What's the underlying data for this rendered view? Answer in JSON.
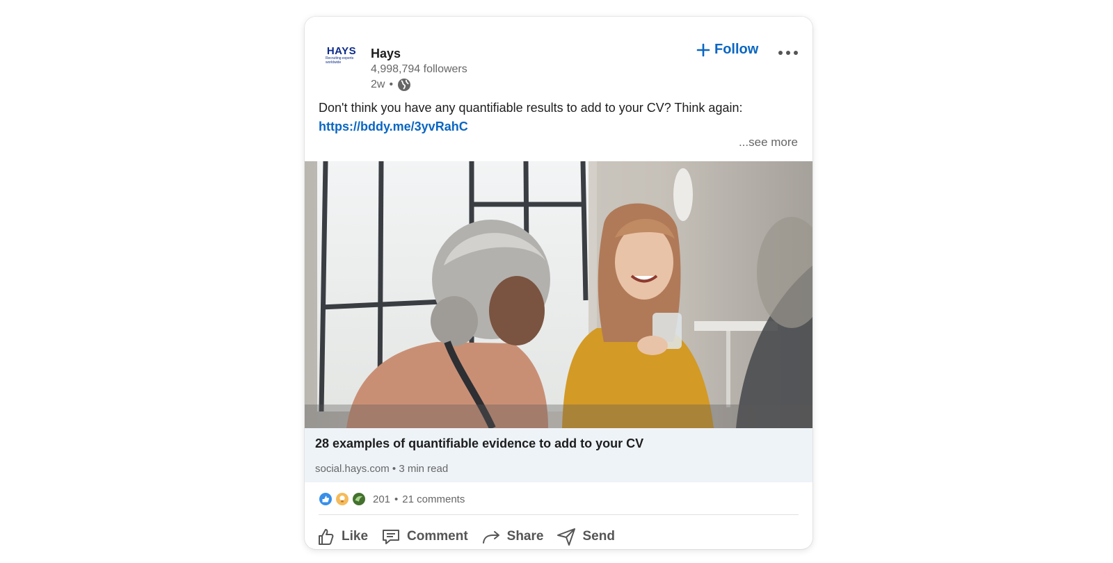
{
  "post": {
    "author": {
      "name": "Hays",
      "followers": "4,998,794 followers",
      "time": "2w",
      "separator": "•",
      "logo_word": "HAYS",
      "logo_tagline": "Recruiting experts worldwide"
    },
    "follow_label": "Follow",
    "text": "Don't think you have any quantifiable results to add to your CV? Think again:",
    "link": "https://bddy.me/3yvRahC",
    "see_more": "...see more",
    "article": {
      "title": "28 examples of quantifiable evidence to add to your CV",
      "source": "social.hays.com",
      "separator": "•",
      "read_time": "3 min read"
    },
    "social": {
      "reaction_icons": [
        "like-icon",
        "insightful-icon",
        "support-icon"
      ],
      "reaction_count": "201",
      "separator": "•",
      "comments": "21 comments"
    },
    "actions": {
      "like": "Like",
      "comment": "Comment",
      "share": "Share",
      "send": "Send"
    }
  },
  "colors": {
    "accent": "#0a66c2",
    "brand": "#0b2a8a",
    "article_bg": "#eef3f8",
    "muted_text": "#666666"
  }
}
